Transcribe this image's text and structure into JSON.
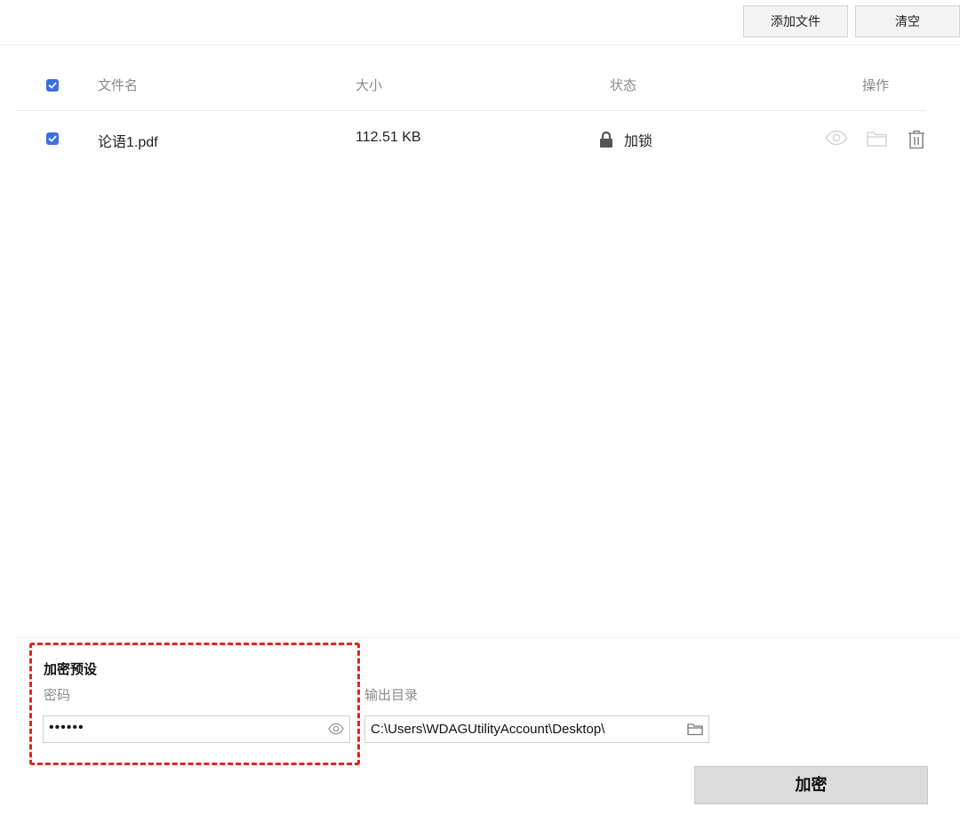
{
  "toolbar": {
    "add_file_label": "添加文件",
    "clear_label": "清空"
  },
  "table": {
    "columns": {
      "name": "文件名",
      "size": "大小",
      "status": "状态",
      "actions": "操作"
    },
    "rows": [
      {
        "checked": true,
        "name": "论语1.pdf",
        "size": "112.51 KB",
        "status": "加锁",
        "status_icon": "lock-icon"
      }
    ]
  },
  "settings": {
    "title": "加密预设",
    "password_label": "密码",
    "password_value": "••••••",
    "output_label": "输出目录",
    "output_value": "C:\\Users\\WDAGUtilityAccount\\Desktop\\"
  },
  "encrypt_label": "加密",
  "colors": {
    "checkbox": "#3a6ee8",
    "highlight": "#e8221c",
    "button_bg": "#dcdcdc"
  }
}
